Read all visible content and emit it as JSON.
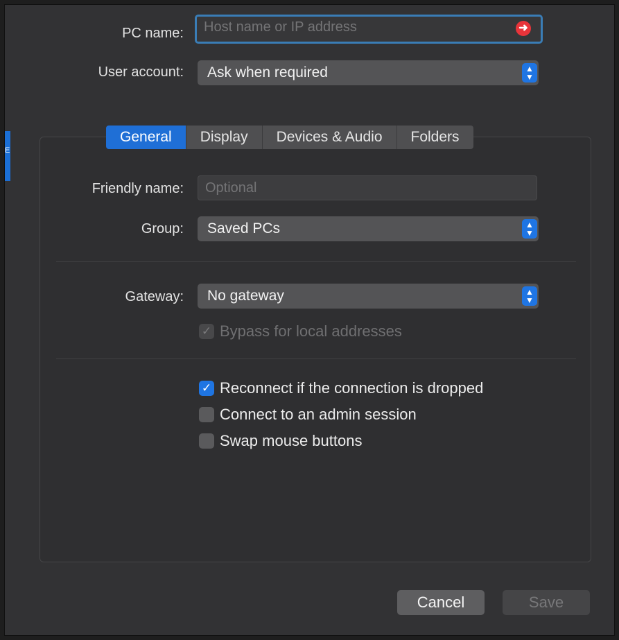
{
  "connection": {
    "pc_name_label": "PC name:",
    "pc_name_placeholder": "Host name or IP address",
    "pc_name_value": "",
    "user_account_label": "User account:",
    "user_account_value": "Ask when required"
  },
  "tabs": [
    {
      "label": "General",
      "active": true
    },
    {
      "label": "Display",
      "active": false
    },
    {
      "label": "Devices & Audio",
      "active": false
    },
    {
      "label": "Folders",
      "active": false
    }
  ],
  "general": {
    "friendly_name_label": "Friendly name:",
    "friendly_name_placeholder": "Optional",
    "group_label": "Group:",
    "group_value": "Saved PCs",
    "gateway_label": "Gateway:",
    "gateway_value": "No gateway",
    "bypass_label": "Bypass for local addresses",
    "bypass_checked": true,
    "options": [
      {
        "label": "Reconnect if the connection is dropped",
        "checked": true
      },
      {
        "label": "Connect to an admin session",
        "checked": false
      },
      {
        "label": "Swap mouse buttons",
        "checked": false
      }
    ]
  },
  "footer": {
    "cancel_label": "Cancel",
    "save_label": "Save"
  },
  "icons": {
    "warning": "exclamation-arrow-icon",
    "stepper": "chevron-up-down-icon",
    "check": "checkmark-icon"
  },
  "colors": {
    "accent": "#1f6fd6",
    "warning": "#e8343a",
    "focus_ring": "#3a7db6"
  }
}
